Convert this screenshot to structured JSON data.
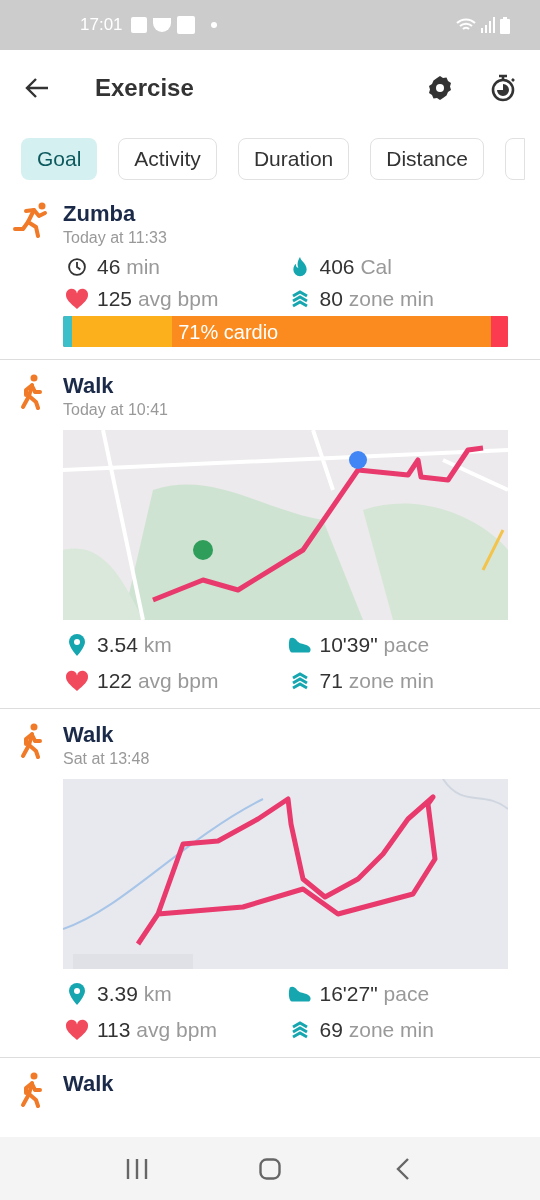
{
  "status_bar": {
    "time": "17:01"
  },
  "header": {
    "title": "Exercise"
  },
  "chips": [
    {
      "label": "Goal",
      "selected": true
    },
    {
      "label": "Activity",
      "selected": false
    },
    {
      "label": "Duration",
      "selected": false
    },
    {
      "label": "Distance",
      "selected": false
    }
  ],
  "entries": [
    {
      "icon": {
        "kind": "run"
      },
      "name": "Zumba",
      "when": "Today at 11:33",
      "kind": "zones",
      "stats": [
        {
          "kind": "duration",
          "value": "46",
          "unit": "min"
        },
        {
          "kind": "calories",
          "value": "406",
          "unit": "Cal"
        },
        {
          "kind": "heart",
          "value": "125",
          "unit": "avg bpm"
        },
        {
          "kind": "zone",
          "value": "80",
          "unit": "zone min"
        }
      ],
      "zones": {
        "label": "71% cardio",
        "color": "#fb3b50",
        "segments": [
          {
            "color": "#3dbfc9",
            "level": 0.02
          },
          {
            "color": "#fbb01c",
            "level": 0.23
          },
          {
            "color": "#fb8b1e",
            "level": 0.95
          }
        ]
      }
    },
    {
      "icon": {
        "kind": "walk"
      },
      "name": "Walk",
      "when": "Today at 10:41",
      "kind": "map",
      "stats": [
        {
          "kind": "distance",
          "value": "3.54",
          "unit": "km"
        },
        {
          "kind": "pace",
          "value": "10'39\"",
          "unit": "pace"
        },
        {
          "kind": "heart",
          "value": "122",
          "unit": "avg bpm"
        },
        {
          "kind": "zone",
          "value": "71",
          "unit": "zone min"
        }
      ]
    },
    {
      "icon": {
        "kind": "walk"
      },
      "name": "Walk",
      "when": "Sat at 13:48",
      "kind": "map",
      "stats": [
        {
          "kind": "distance",
          "value": "3.39",
          "unit": "km"
        },
        {
          "kind": "pace",
          "value": "16'27\"",
          "unit": "pace"
        },
        {
          "kind": "heart",
          "value": "113",
          "unit": "avg bpm"
        },
        {
          "kind": "zone",
          "value": "69",
          "unit": "zone min"
        }
      ]
    },
    {
      "icon": {
        "kind": "walk"
      },
      "name": "Walk",
      "kind": "cut"
    }
  ]
}
